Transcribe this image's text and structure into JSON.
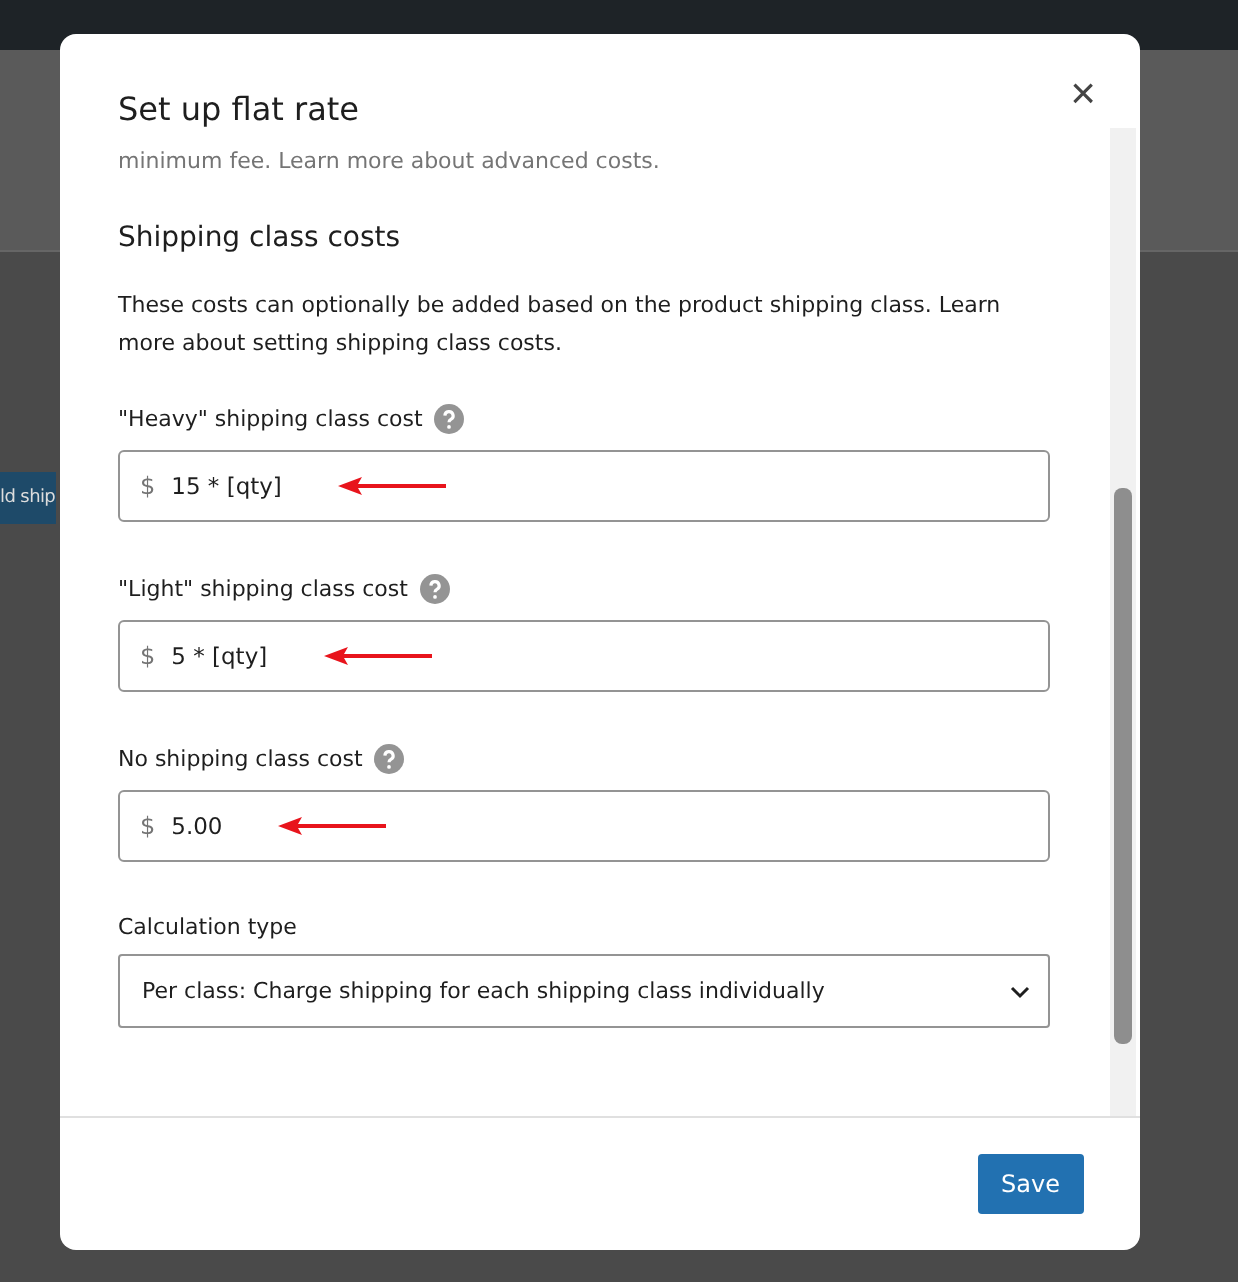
{
  "background": {
    "button_label": "ld ship"
  },
  "modal": {
    "title": "Set up flat rate",
    "close": "×",
    "cut_text": "minimum fee. Learn more about advanced costs.",
    "section_title": "Shipping class costs",
    "section_text": "These costs can optionally be added based on the product shipping class. Learn more about setting shipping class costs.",
    "fields": [
      {
        "label": "\"Heavy\" shipping class cost",
        "prefix": "$",
        "value": "15 * [qty]",
        "annotated": true
      },
      {
        "label": "\"Light\" shipping class cost",
        "prefix": "$",
        "value": "5 * [qty]",
        "annotated": true
      },
      {
        "label": "No shipping class cost",
        "prefix": "$",
        "value": "5.00",
        "annotated": true
      }
    ],
    "calculation": {
      "label": "Calculation type",
      "value": "Per class: Charge shipping for each shipping class individually"
    },
    "save": "Save"
  }
}
